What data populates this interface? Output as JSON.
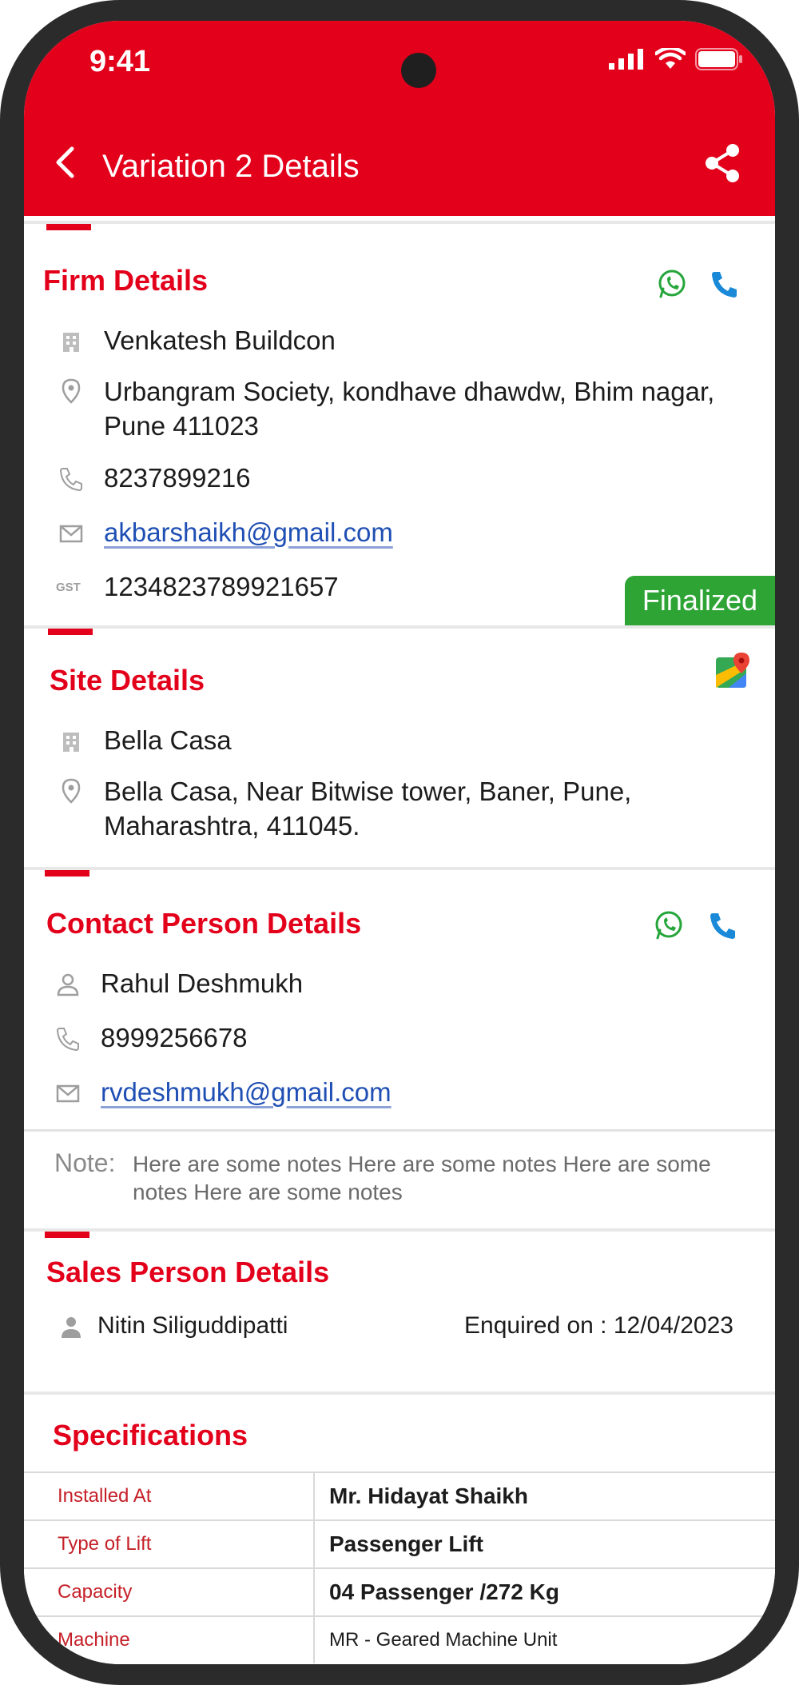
{
  "status": {
    "time": "9:41"
  },
  "app_bar": {
    "title": "Variation 2 Details"
  },
  "firm": {
    "title": "Firm Details",
    "name": "Venkatesh Buildcon",
    "address": "Urbangram Society, kondhave dhawdw, Bhim nagar, Pune 411023",
    "phone": "8237899216",
    "email": "akbarshaikh@gmail.com",
    "gst_label": "GST",
    "gst": "1234823789921657",
    "status_badge": "Finalized"
  },
  "site": {
    "title": "Site Details",
    "name": "Bella Casa",
    "address": "Bella Casa, Near Bitwise tower, Baner, Pune, Maharashtra, 411045."
  },
  "contact": {
    "title": "Contact Person Details",
    "name": "Rahul Deshmukh",
    "phone": "8999256678",
    "email": "rvdeshmukh@gmail.com",
    "note_label": "Note:",
    "note": "Here are some notes Here are some notes Here are some notes Here are some notes"
  },
  "sales": {
    "title": "Sales Person Details",
    "name": "Nitin Siliguddipatti",
    "enquired": "Enquired on : 12/04/2023"
  },
  "specifications": {
    "title": "Specifications",
    "rows": [
      {
        "label": "Installed At",
        "value": "Mr. Hidayat Shaikh"
      },
      {
        "label": "Type of Lift",
        "value": "Passenger Lift"
      },
      {
        "label": "Capacity",
        "value": "04 Passenger /272 Kg"
      },
      {
        "label": "Machine",
        "value": "MR - Geared Machine Unit"
      }
    ]
  },
  "colors": {
    "brand_red": "#e3001b",
    "finalized_green": "#2ea435",
    "link_blue": "#1f4fb4",
    "whatsapp_green": "#25a53a",
    "call_blue": "#1a8ad8"
  }
}
